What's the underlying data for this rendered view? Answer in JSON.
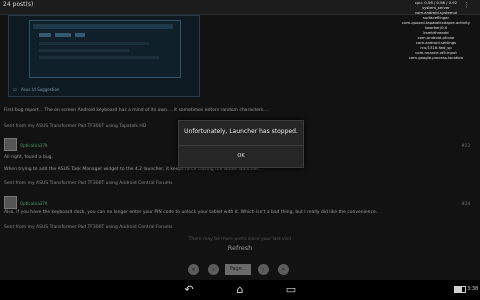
{
  "title_bar": {
    "title": "24 post(s)",
    "menu_icon": "overflow-menu-icon"
  },
  "debug_overlay": [
    "cpu: 0.56 / 0.98 / 0.92",
    "system_server",
    "com.android.systemui",
    "surfaceflinger",
    "com.quoord.tapatalkxdapre.activity",
    "kworker/0:0",
    "ksmbthreadd",
    "com.android.phone",
    "com.android.settings",
    "rcu/1316-fwd_sp",
    "com.nuance.xt9.input",
    "com.google.process.location"
  ],
  "screenshot_caption": "Asus UI Suggestion",
  "posts": [
    {
      "text_lines": [
        "First bug report... The on screen Android keyboard has a mind of its own.... it sometimes enters random characters....",
        "Sent from my ASUS Transformer Pad TF300T using Tapatalk HD"
      ]
    },
    {
      "user": "Opticalsia379",
      "number": "#23",
      "text_lines": [
        "All right, found a bug.",
        "When trying to add the ASUS Task Manager widget to the 4.2 launcher, it keeps force closing the whole launcher.",
        "Sent from my ASUS Transformer Pad TF300T using Android Central Forums"
      ]
    },
    {
      "user": "Opticalsia379",
      "number": "#24",
      "text_lines": [
        "Also, if you have the keyboard dock, you can no longer enter your PIN code to unlock your tablet with it. Which isn't a bad thing, but I really did like the convenience.",
        "Sent from my ASUS Transformer Pad TF300T using Android Central Forums"
      ]
    }
  ],
  "dialog": {
    "message": "Unfortunately, Launcher has stopped.",
    "ok_label": "OK"
  },
  "more_posts_text": "There may be more posts since your last visit",
  "refresh_label": "Refresh",
  "pager": {
    "page_label": "Page..."
  },
  "navbar": {
    "back_icon": "back-icon",
    "home_icon": "home-icon",
    "recents_icon": "recents-icon",
    "clock": "3:38",
    "battery_level": 0.7
  }
}
